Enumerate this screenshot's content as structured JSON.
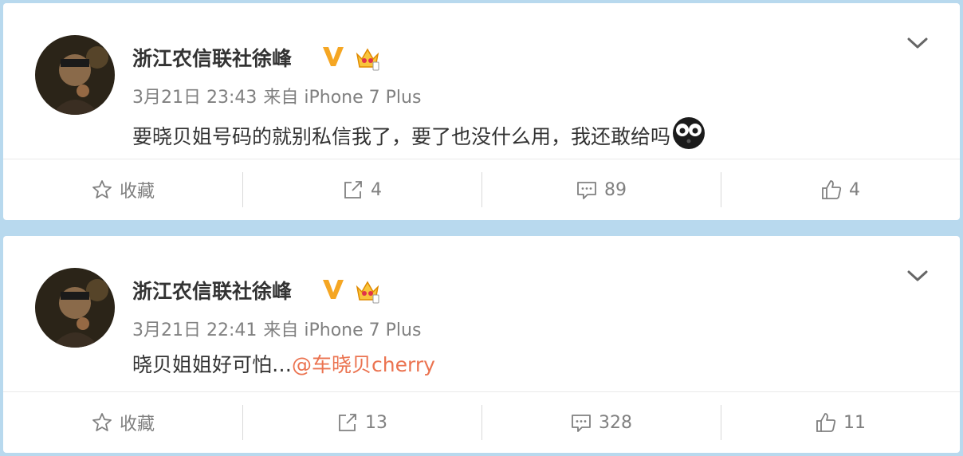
{
  "posts": [
    {
      "username": "浙江农信联社徐峰",
      "verified_badge": "V",
      "time": "3月21日 23:43",
      "source": "来自 iPhone 7 Plus",
      "text": "要晓贝姐号码的就别私信我了，要了也没什么用，我还敢给吗",
      "mention": "",
      "emoji": "doge-eyes-emoji",
      "actions": {
        "favorite": "收藏",
        "repost": "4",
        "comment": "89",
        "like": "4"
      }
    },
    {
      "username": "浙江农信联社徐峰",
      "verified_badge": "V",
      "time": "3月21日 22:41",
      "source": "来自 iPhone 7 Plus",
      "text": "晓贝姐姐好可怕…",
      "mention": "@车晓贝cherry",
      "emoji": "",
      "actions": {
        "favorite": "收藏",
        "repost": "13",
        "comment": "328",
        "like": "11"
      }
    }
  ],
  "colors": {
    "background": "#b8d9ee",
    "card": "#ffffff",
    "text": "#333333",
    "meta": "#808080",
    "mention": "#eb7350",
    "verified": "#f5a623"
  },
  "icons": {
    "menu": "chevron-down-icon",
    "favorite": "star-icon",
    "repost": "share-icon",
    "comment": "comment-icon",
    "like": "thumbs-up-icon"
  }
}
